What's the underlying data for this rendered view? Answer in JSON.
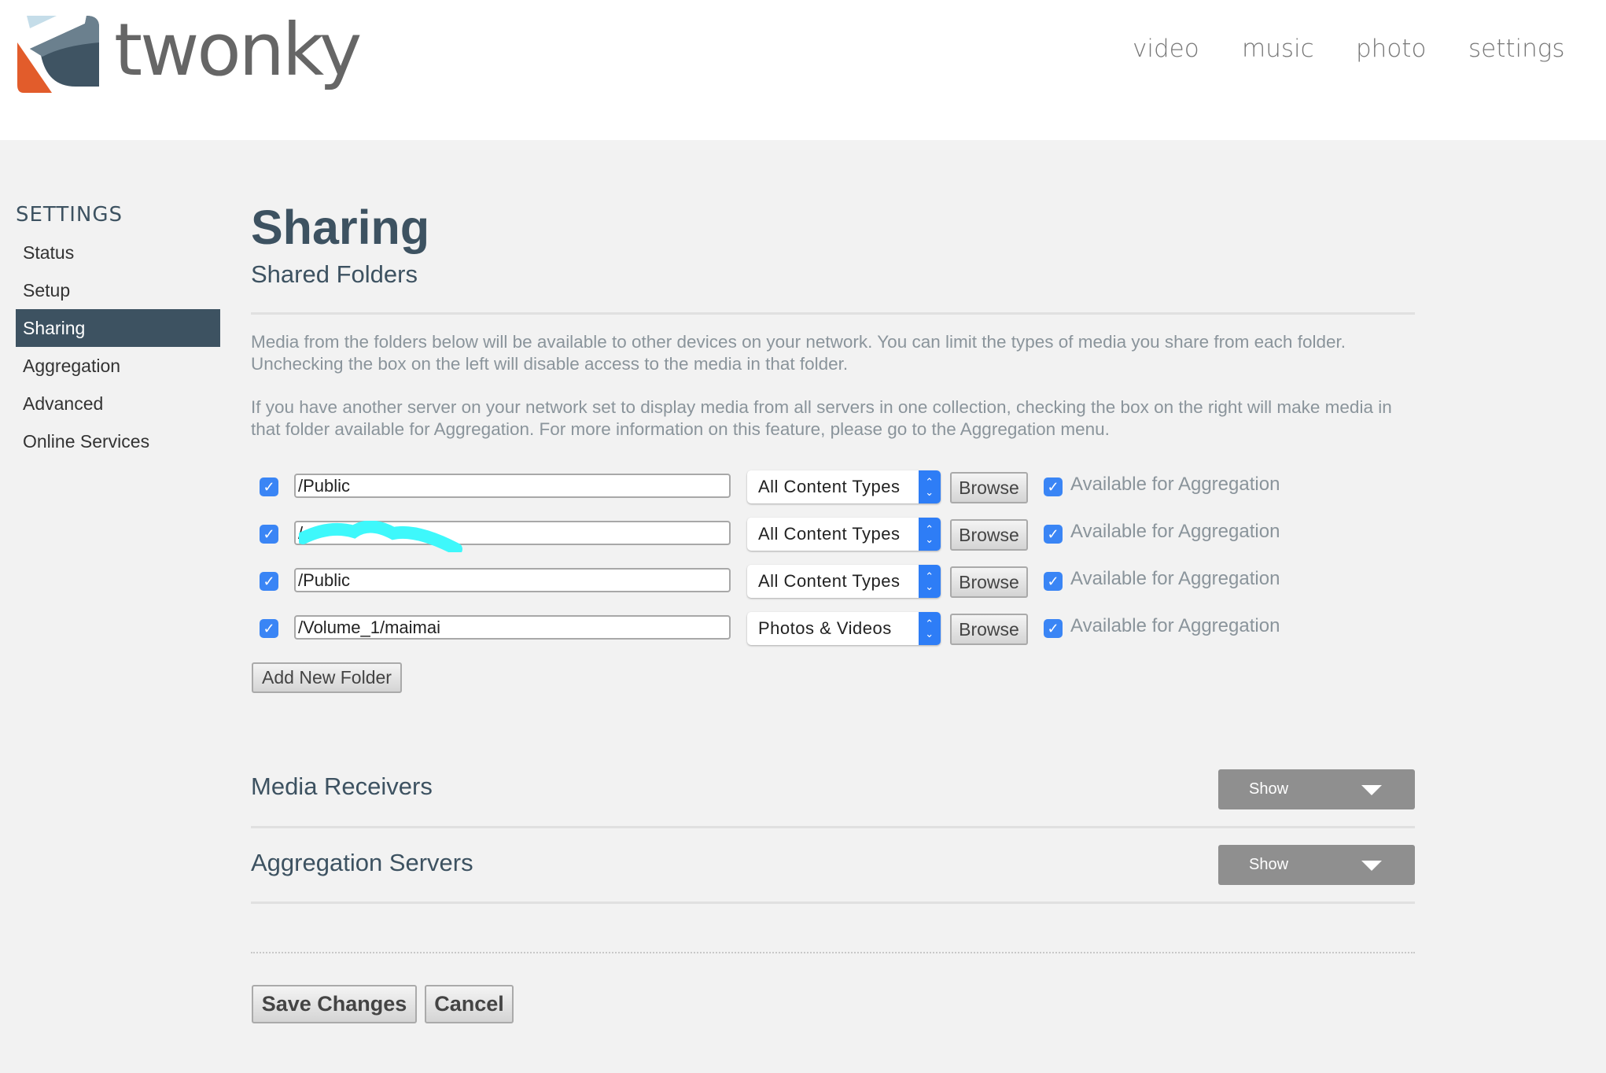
{
  "header": {
    "logo_text": "twonky",
    "nav": [
      "video",
      "music",
      "photo",
      "settings"
    ]
  },
  "sidebar": {
    "title": "SETTINGS",
    "items": [
      "Status",
      "Setup",
      "Sharing",
      "Aggregation",
      "Advanced",
      "Online Services"
    ],
    "active": "Sharing"
  },
  "main": {
    "title": "Sharing",
    "subtitle": "Shared Folders",
    "para1": "Media from the folders below will be available to other devices on your network. You can limit the types of media you share from each folder. Unchecking the box on the left will disable access to the media in that folder.",
    "para2": "If you have another server on your network set to display media from all servers in one collection, checking the box on the right will make media in that folder available for Aggregation. For more information on this feature, please go to the Aggregation menu.",
    "folders": [
      {
        "path": "/Public",
        "type": "All Content Types",
        "enabled": true,
        "aggregation": true
      },
      {
        "path": "/",
        "type": "All Content Types",
        "enabled": true,
        "aggregation": true
      },
      {
        "path": "/Public",
        "type": "All Content Types",
        "enabled": true,
        "aggregation": true
      },
      {
        "path": "/Volume_1/maimai",
        "type": "Photos & Videos",
        "enabled": true,
        "aggregation": true
      }
    ],
    "browse_label": "Browse",
    "aggregation_label": "Available for Aggregation",
    "add_folder_label": "Add New Folder",
    "sections": [
      {
        "title": "Media Receivers",
        "button": "Show"
      },
      {
        "title": "Aggregation Servers",
        "button": "Show"
      }
    ],
    "save_label": "Save Changes",
    "cancel_label": "Cancel"
  }
}
